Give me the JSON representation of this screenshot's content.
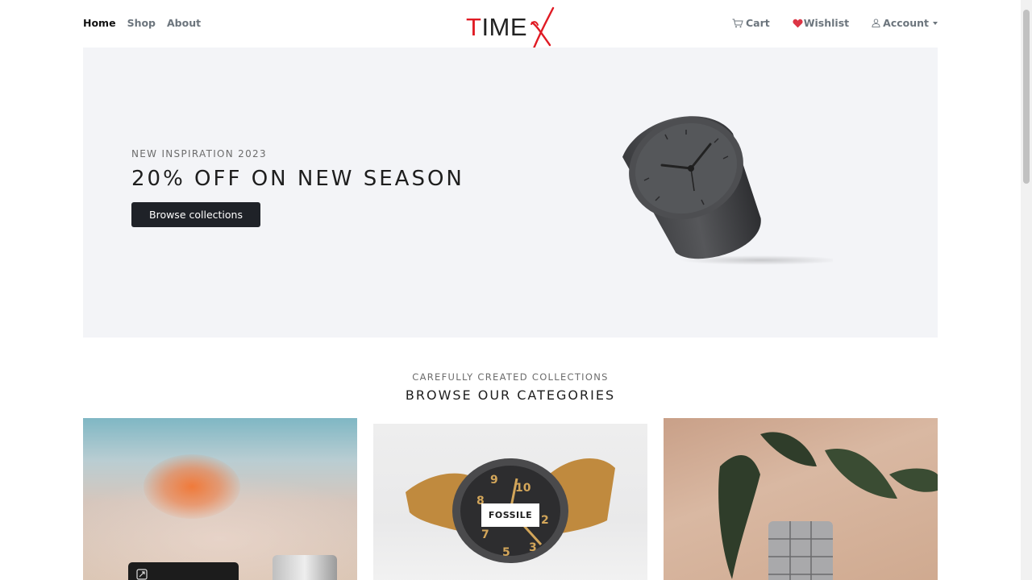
{
  "nav": {
    "links": [
      {
        "label": "Home",
        "active": true
      },
      {
        "label": "Shop",
        "active": false
      },
      {
        "label": "About",
        "active": false
      }
    ],
    "logo": {
      "text_t": "T",
      "text_rest": "IME",
      "mark": "X"
    },
    "right": {
      "cart": "Cart",
      "wishlist": "Wishlist",
      "account": "Account"
    }
  },
  "hero": {
    "subtitle": "NEW INSPIRATION 2023",
    "title": "20% OFF ON NEW SEASON",
    "button": "Browse collections"
  },
  "categories": {
    "subtitle": "CAREFULLY CREATED COLLECTIONS",
    "title": "BROWSE OUR CATEGORIES",
    "items": [
      {
        "label": ""
      },
      {
        "label": "FOSSILE"
      },
      {
        "label": ""
      }
    ]
  },
  "colors": {
    "accent": "#e01b24",
    "hero_bg": "#f3f4f7",
    "button_bg": "#1f2228",
    "heart": "#dc3545"
  },
  "icons": {
    "cart": "cart-icon",
    "wishlist": "heart-icon",
    "account": "person-icon",
    "float": "expand-icon"
  }
}
